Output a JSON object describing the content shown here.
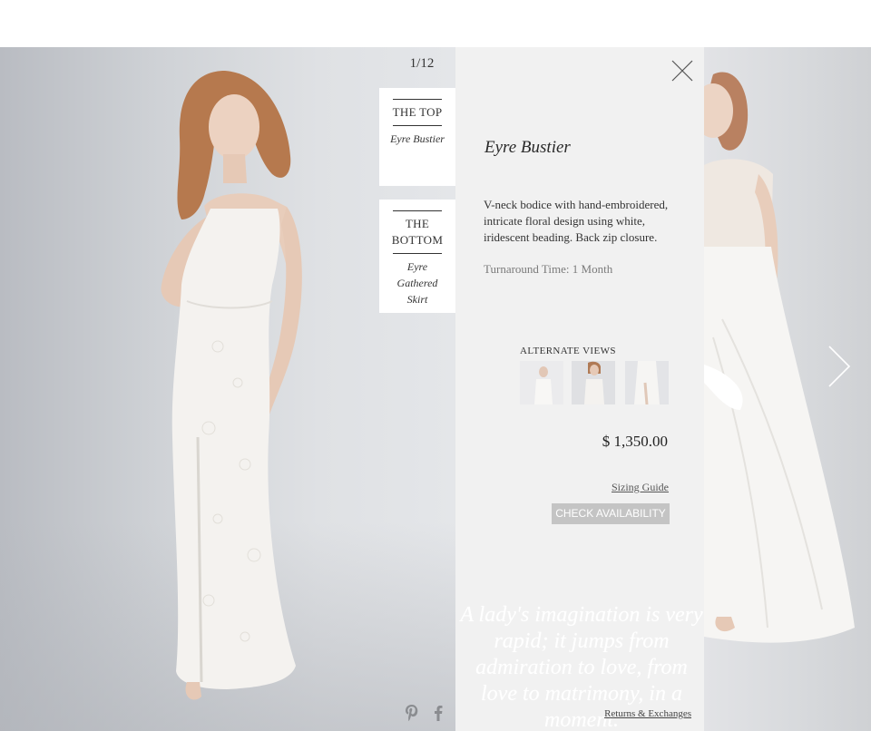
{
  "gallery": {
    "counter": "1/12"
  },
  "outfit": {
    "top": {
      "part": "THE TOP",
      "item": "Eyre Bustier"
    },
    "bottom": {
      "part": "THE BOTTOM",
      "item": "Eyre Gathered Skirt"
    }
  },
  "product": {
    "name": "Eyre Bustier",
    "description": "V-neck bodice with hand-embroidered, intricate floral design using white, iridescent beading. Back zip closure.",
    "turnaround": "Turnaround Time: 1 Month",
    "alternate_views_label": "Alternate Views",
    "alternate_views_count": 3,
    "price": "$ 1,350.00",
    "sizing_guide": "Sizing Guide",
    "check_availability": "CHECK AVAILABILITY",
    "quote": "A lady's imagination is very rapid; it jumps from admiration to love, from love to matrimony, in a moment.",
    "returns": "Returns & Exchanges"
  },
  "icons": {
    "close": "close-icon",
    "next": "chevron-right-icon",
    "pinterest": "pinterest-icon",
    "facebook": "facebook-icon"
  },
  "colors": {
    "panel_bg": "#f1f1f1",
    "button_bg": "#c4c4c4",
    "button_text": "#ffffff"
  }
}
